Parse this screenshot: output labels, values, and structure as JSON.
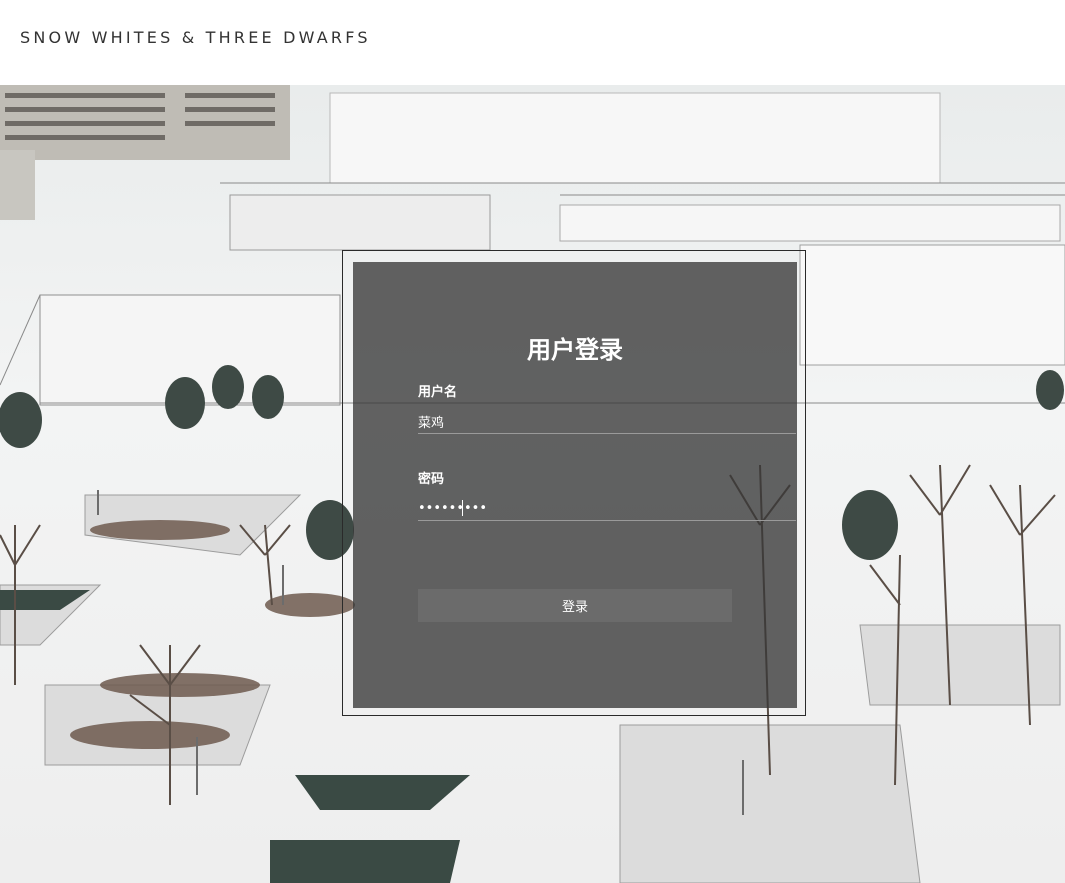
{
  "header": {
    "brand": "SNOW WHITES & THREE DWARFS"
  },
  "login": {
    "title": "用户登录",
    "username_label": "用户名",
    "username_value": "菜鸡",
    "password_label": "密码",
    "password_value": "•••••••••",
    "submit_label": "登录"
  },
  "colors": {
    "panel_bg": "#373737",
    "button_bg": "#6b6b6b",
    "text": "#ffffff",
    "brand_text": "#333333"
  }
}
